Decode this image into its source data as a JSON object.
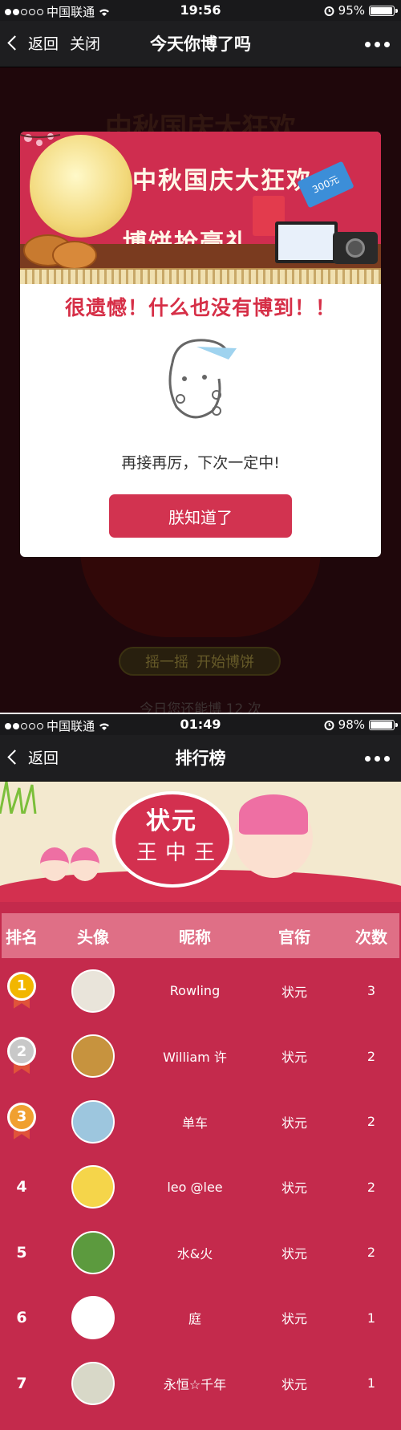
{
  "screen1": {
    "status": {
      "carrier": "中国联通",
      "time": "19:56",
      "battery": "95%",
      "battery_level": 0.95
    },
    "nav": {
      "back_label": "返回",
      "close_label": "关闭",
      "title": "今天你博了吗"
    },
    "background": {
      "title": "中秋国庆大狂欢",
      "shake_label": "摇一摇",
      "start_label": "开始博饼",
      "remaining_text": "今日您还能博 12 次"
    },
    "modal": {
      "banner_line1": "中秋国庆大狂欢",
      "banner_line2": "博饼抢豪礼",
      "ticket_text": "300元",
      "headline": "很遗憾！什么也没有博到！！",
      "message": "再接再厉，下次一定中!",
      "button_label": "朕知道了"
    }
  },
  "screen2": {
    "status": {
      "carrier": "中国联通",
      "time": "01:49",
      "battery": "98%",
      "battery_level": 0.98
    },
    "nav": {
      "back_label": "返回",
      "title": "排行榜"
    },
    "banner": {
      "seal_line1": "状元",
      "seal_line2": "王中王"
    },
    "table": {
      "headers": [
        "排名",
        "头像",
        "昵称",
        "官衔",
        "次数"
      ],
      "rows": [
        {
          "rank": "1",
          "nickname": "Rowling",
          "title": "状元",
          "count": "3",
          "medal": "gold",
          "avatar": "flower-avatar",
          "avatar_color": "#e9e4da"
        },
        {
          "rank": "2",
          "nickname": "William 许",
          "title": "状元",
          "count": "2",
          "medal": "silver",
          "avatar": "cartoon-avatar",
          "avatar_color": "#c7933e"
        },
        {
          "rank": "3",
          "nickname": "单车",
          "title": "状元",
          "count": "2",
          "medal": "bronze",
          "avatar": "doll-avatar",
          "avatar_color": "#9dc6de"
        },
        {
          "rank": "4",
          "nickname": "leo @lee",
          "title": "状元",
          "count": "2",
          "medal": "",
          "avatar": "minion-avatar",
          "avatar_color": "#f5d54a"
        },
        {
          "rank": "5",
          "nickname": "水&火",
          "title": "状元",
          "count": "2",
          "medal": "",
          "avatar": "landscape-avatar",
          "avatar_color": "#5c9a3e"
        },
        {
          "rank": "6",
          "nickname": "庭",
          "title": "状元",
          "count": "1",
          "medal": "",
          "avatar": "cartoon-girl-avatar",
          "avatar_color": "#ffffff"
        },
        {
          "rank": "7",
          "nickname": "永恒☆千年",
          "title": "状元",
          "count": "1",
          "medal": "",
          "avatar": "sketch-avatar",
          "avatar_color": "#d8d8c8"
        }
      ]
    }
  },
  "colors": {
    "gold": "#f2b600",
    "silver": "#c8c8c8",
    "bronze": "#f0a030",
    "accent_red": "#d23350",
    "table_bg": "#c42a4c",
    "header_bg": "#df6f86"
  }
}
